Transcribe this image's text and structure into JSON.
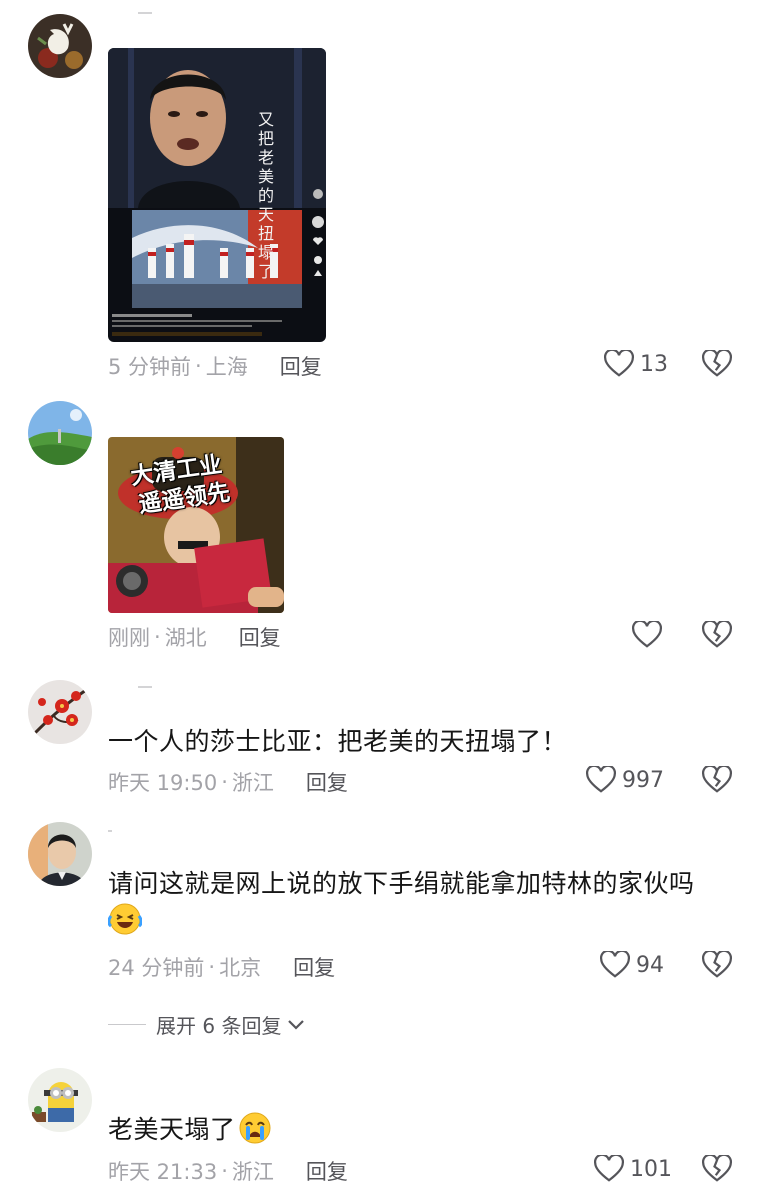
{
  "comments": [
    {
      "avatar": "white-bird-avatar",
      "media_caption": "又把老美的天扭塌了",
      "time": "5 分钟前",
      "location": "上海",
      "reply": "回复",
      "likes": "13"
    },
    {
      "avatar": "green-hill-avatar",
      "media_caption_line1": "大清工业",
      "media_caption_line2": "遥遥领先",
      "time": "刚刚",
      "location": "湖北",
      "reply": "回复",
      "likes": ""
    },
    {
      "avatar": "red-plum-avatar",
      "text": "一个人的莎士比亚：把老美的天扭塌了！",
      "time": "昨天 19:50",
      "location": "浙江",
      "reply": "回复",
      "likes": "997"
    },
    {
      "avatar": "person-avatar",
      "text": "请问这就是网上说的放下手绢就能拿加特林的家伙吗",
      "emoji": "laugh-cry-emoji",
      "time": "24 分钟前",
      "location": "北京",
      "reply": "回复",
      "likes": "94"
    },
    {
      "avatar": "minion-avatar",
      "text": "老美天塌了",
      "emoji": "crying-emoji",
      "time": "昨天 21:33",
      "location": "浙江",
      "reply": "回复",
      "likes": "101"
    }
  ],
  "expand_replies": "展开 6 条回复",
  "separator": "·",
  "colors": {
    "meta_gray": "#a3a3a8",
    "action_gray": "#55555a",
    "text": "#161616"
  }
}
